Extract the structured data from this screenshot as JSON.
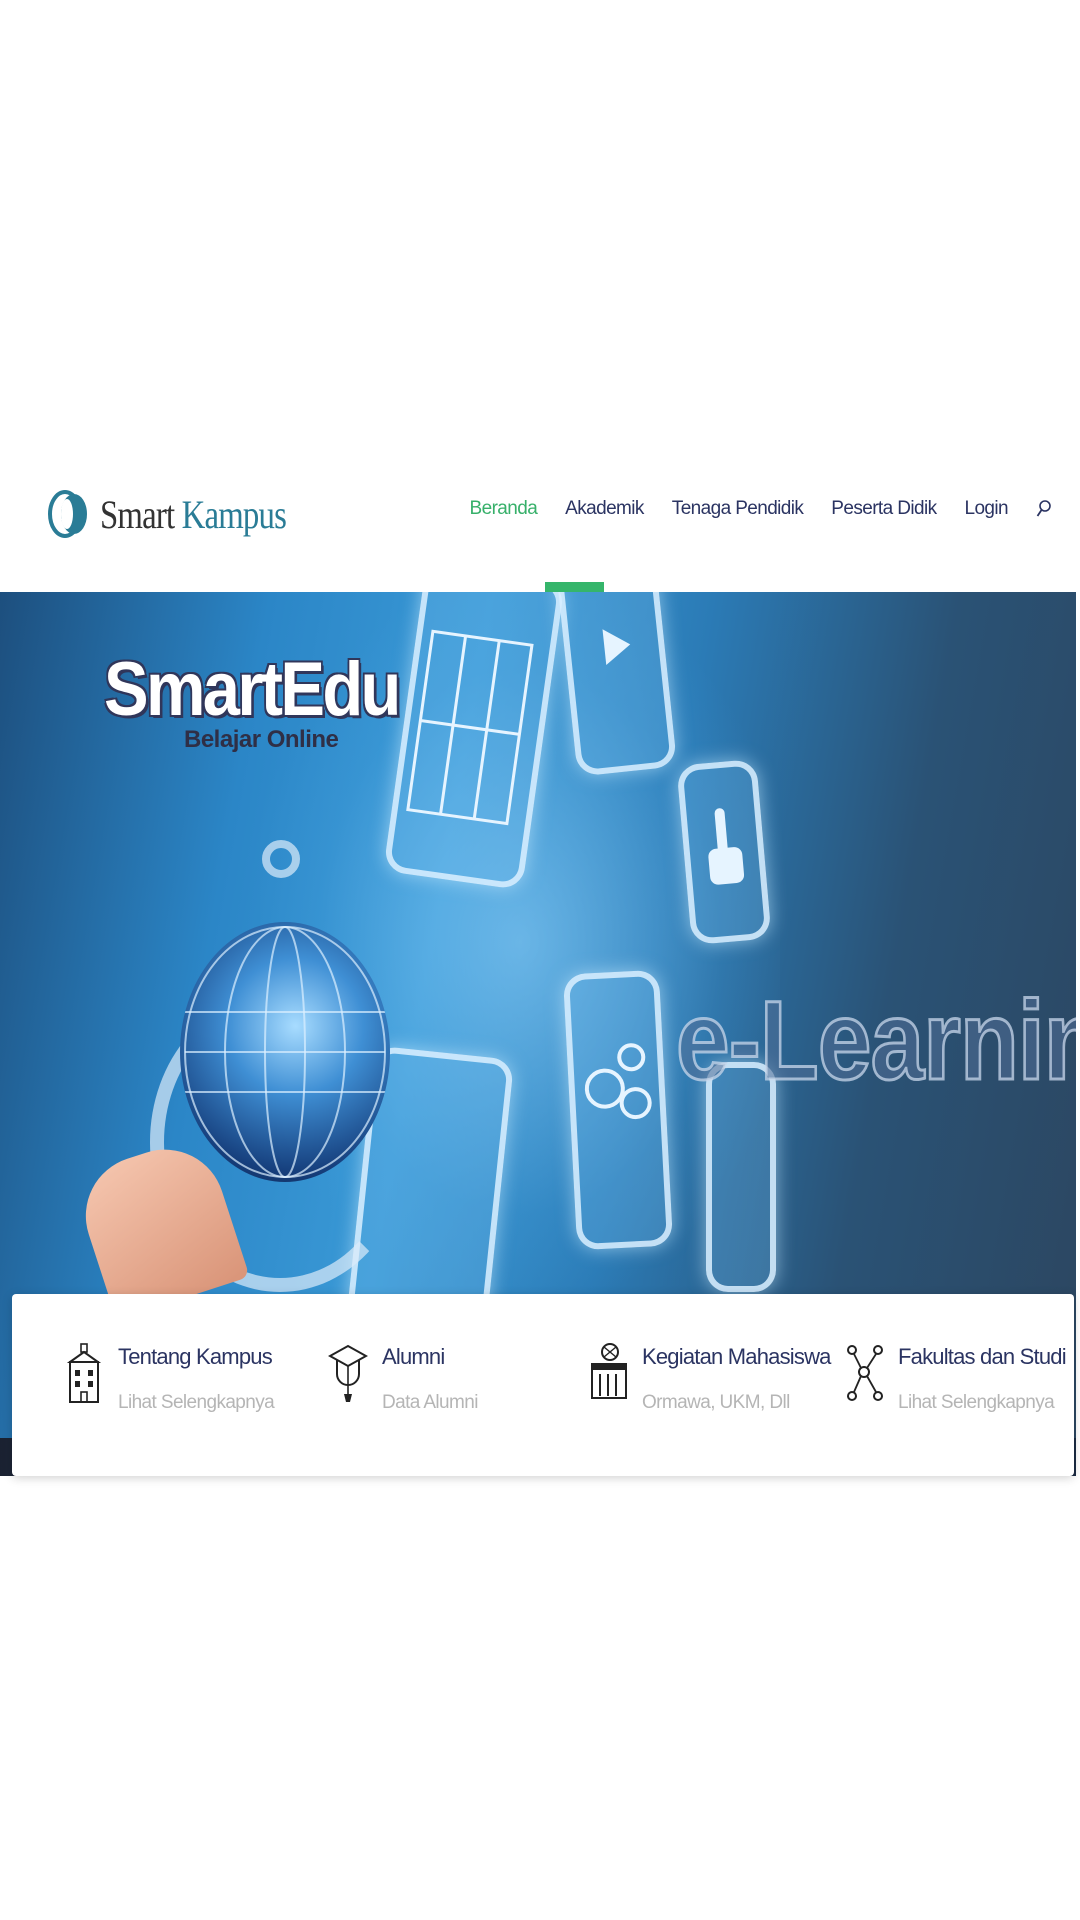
{
  "brand": {
    "name_part1": "Smart",
    "name_part2": "Kampus",
    "accent": "#35b56b",
    "nav_color": "#2b3462",
    "logo_color": "#2a7c96"
  },
  "nav": {
    "items": [
      {
        "label": "Beranda",
        "active": true
      },
      {
        "label": "Akademik",
        "active": false
      },
      {
        "label": "Tenaga Pendidik",
        "active": false
      },
      {
        "label": "Peserta Didik",
        "active": false
      },
      {
        "label": "Login",
        "active": false
      }
    ],
    "search_icon": "search-icon"
  },
  "hero": {
    "title": "SmartEdu",
    "subtitle": "Belajar Online",
    "overlay_text": "e-Learning"
  },
  "features": [
    {
      "icon": "building-icon",
      "title": "Tentang Kampus",
      "subtitle": "Lihat Selengkapnya"
    },
    {
      "icon": "graduation-cap-icon",
      "title": "Alumni",
      "subtitle": "Data Alumni"
    },
    {
      "icon": "activity-icon",
      "title": "Kegiatan Mahasiswa",
      "subtitle": "Ormawa, UKM, Dll"
    },
    {
      "icon": "network-icon",
      "title": "Fakultas dan Studi",
      "subtitle": "Lihat Selengkapnya"
    }
  ]
}
